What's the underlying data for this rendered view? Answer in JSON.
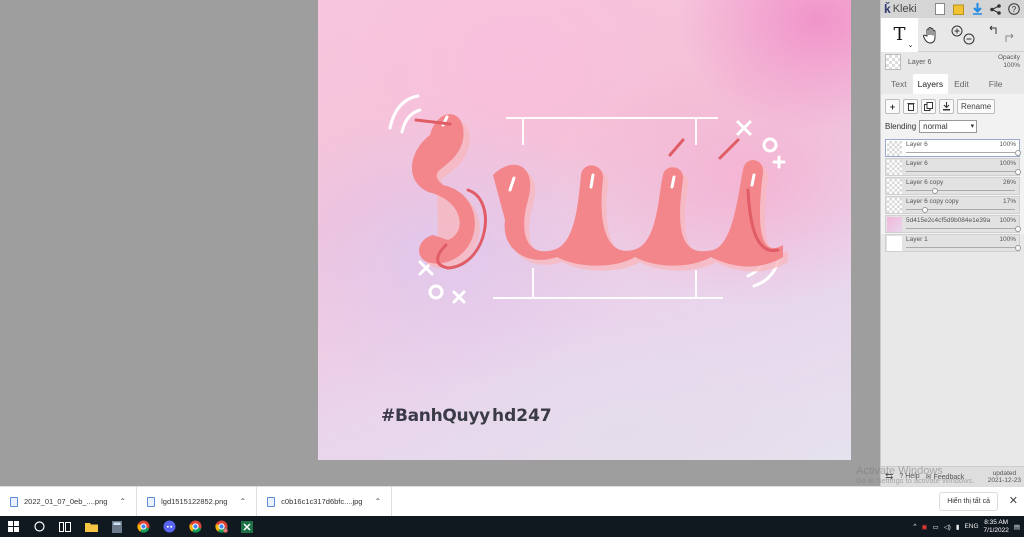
{
  "app": {
    "name": "Kleki"
  },
  "canvas": {
    "hashtag": "#BanhQuyy",
    "credit": "hd247",
    "colors": {
      "lettering": "#f38e8e",
      "lettering_outline": "#e05d66",
      "decor": "#ffffff"
    }
  },
  "toolbar": {
    "icons": [
      "new-icon",
      "save-icon",
      "download-icon",
      "share-icon",
      "help-icon"
    ]
  },
  "tools": {
    "text": "T",
    "icons": [
      "text-tool-icon",
      "hand-tool-icon",
      "zoom-in-icon",
      "zoom-out-icon",
      "undo-icon",
      "redo-icon"
    ]
  },
  "current_layer": {
    "name": "Layer 6",
    "opacity_label": "Opacity",
    "opacity_value": "100%"
  },
  "tabs": [
    {
      "label": "Text",
      "active": false
    },
    {
      "label": "Layers",
      "active": true
    },
    {
      "label": "Edit",
      "active": false
    },
    {
      "label": "File",
      "active": false
    }
  ],
  "layers_panel": {
    "rename_label": "Rename",
    "blending_label": "Blending",
    "blending_value": "normal",
    "layers": [
      {
        "name": "Layer 6",
        "opacity": "100%",
        "level": 1.0,
        "selected": true
      },
      {
        "name": "Layer 6",
        "opacity": "100%",
        "level": 1.0,
        "selected": false
      },
      {
        "name": "Layer 6 copy",
        "opacity": "26%",
        "level": 0.26,
        "selected": false
      },
      {
        "name": "Layer 6 copy copy",
        "opacity": "17%",
        "level": 0.17,
        "selected": false
      },
      {
        "name": "5d415e2c4cf5d9b084e1e39a",
        "opacity": "100%",
        "level": 1.0,
        "selected": false
      },
      {
        "name": "Layer 1",
        "opacity": "100%",
        "level": 1.0,
        "selected": false
      }
    ]
  },
  "panel_footer": {
    "help": "Help",
    "feedback": "Feedback",
    "updated_label": "updated",
    "updated_date": "2021-12-23"
  },
  "watermark": {
    "line1": "Activate Windows",
    "line2": "Go to Settings to activate Windows."
  },
  "downloads": {
    "items": [
      {
        "name": "2022_01_07_0eb_....png"
      },
      {
        "name": "lgd1515122852.png"
      },
      {
        "name": "c0b16c1c317d6bfc....jpg"
      }
    ],
    "show_all": "Hiển thị tất cả"
  },
  "taskbar": {
    "language": "ENG",
    "time": "8:35 AM",
    "date": "7/1/2022"
  }
}
